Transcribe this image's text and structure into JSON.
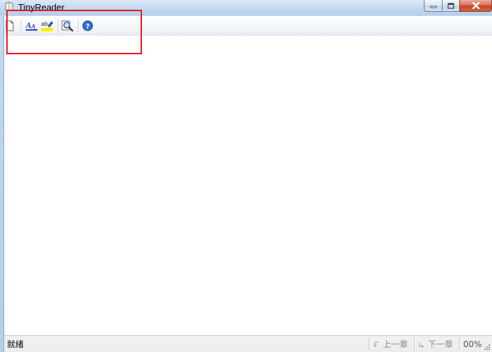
{
  "window": {
    "title": "TinyReader",
    "icons": {
      "app": "book-icon",
      "minimize": "minimize-icon",
      "maximize": "maximize-icon",
      "close": "close-icon"
    }
  },
  "toolbar": {
    "buttons": [
      {
        "name": "new-document-button",
        "icon": "new-document-icon"
      },
      {
        "name": "font-button",
        "icon": "font-icon"
      },
      {
        "name": "highlight-color-button",
        "icon": "highlight-color-icon"
      },
      {
        "name": "find-button",
        "icon": "magnifier-icon"
      },
      {
        "name": "help-button",
        "icon": "help-icon"
      }
    ]
  },
  "statusbar": {
    "status": "就绪",
    "prev_chapter": "上一章",
    "next_chapter": "下一章",
    "progress": "00%"
  },
  "annotation": {
    "color": "#e8151b"
  }
}
